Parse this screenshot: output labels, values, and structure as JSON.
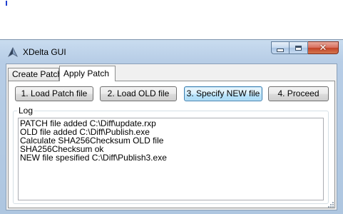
{
  "window": {
    "title": "XDelta GUI",
    "colors": {
      "frame": "#b7cde6",
      "close_button": "#c24327",
      "focused_button_border": "#3c7fb1"
    }
  },
  "tabs": [
    {
      "label": "Create Patch",
      "active": false
    },
    {
      "label": "Apply Patch",
      "active": true
    }
  ],
  "buttons": {
    "load_patch": "1. Load Patch file",
    "load_old": "2. Load OLD file",
    "specify_new": "3. Specify NEW file",
    "proceed": "4. Proceed"
  },
  "log": {
    "label": "Log",
    "lines": [
      "PATCH file added C:\\Diff\\update.rxp",
      "OLD file added C:\\Diff\\Publish.exe",
      "Calculate SHA256Checksum OLD file",
      "SHA256Checksum ok",
      "NEW file spesified C:\\Diff\\Publish3.exe"
    ]
  },
  "icons": {
    "app": "xdelta-app-icon",
    "minimize": "minimize-icon",
    "maximize": "maximize-icon",
    "close": "close-icon"
  }
}
